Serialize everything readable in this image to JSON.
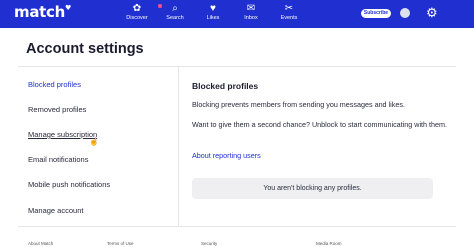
{
  "brand": {
    "logo": "match",
    "heart": "♥"
  },
  "nav": {
    "items": [
      {
        "label": "Discover",
        "icon": "✿"
      },
      {
        "label": "Search",
        "icon": "⌕"
      },
      {
        "label": "Likes",
        "icon": "♥"
      },
      {
        "label": "Inbox",
        "icon": "✉"
      },
      {
        "label": "Events",
        "icon": "✂"
      }
    ],
    "subscribe_label": "Subscribe",
    "settings_icon": "⚙"
  },
  "page": {
    "title": "Account settings"
  },
  "menu": {
    "items": [
      {
        "label": "Blocked profiles"
      },
      {
        "label": "Removed profiles"
      },
      {
        "label": "Manage subscription"
      },
      {
        "label": "Email notifications"
      },
      {
        "label": "Mobile push notifications"
      },
      {
        "label": "Manage account"
      }
    ]
  },
  "content": {
    "title": "Blocked profiles",
    "description": "Blocking prevents members from sending you messages and likes.",
    "second_chance": "Want to give them a second chance? Unblock to start communicating with them.",
    "link_label": "About reporting users",
    "empty_message": "You aren't blocking any profiles."
  },
  "footer": {
    "items": [
      "About Match",
      "Terms of Use",
      "Security",
      "Media Room"
    ]
  },
  "colors": {
    "brand_blue": "#1f2fd0",
    "notification_dot": "#ff4f8b",
    "empty_box": "#efeff2"
  }
}
